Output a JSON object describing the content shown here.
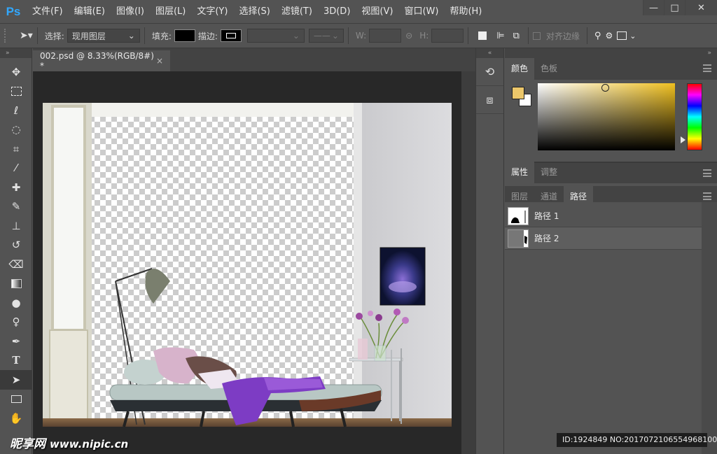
{
  "app": {
    "logo": "Ps"
  },
  "menu": [
    "文件(F)",
    "编辑(E)",
    "图像(I)",
    "图层(L)",
    "文字(Y)",
    "选择(S)",
    "滤镜(T)",
    "3D(D)",
    "视图(V)",
    "窗口(W)",
    "帮助(H)"
  ],
  "window_controls": {
    "minimize": "—",
    "restore": "□",
    "close": "✕"
  },
  "options": {
    "select_label": "选择:",
    "select_value": "现用图层",
    "fill_label": "填充:",
    "stroke_label": "描边:",
    "w_label": "W:",
    "h_label": "H:",
    "align_label": "对齐边缘"
  },
  "document": {
    "tab_title": "002.psd @ 8.33%(RGB/8#) *",
    "close": "×"
  },
  "color_panel": {
    "tabs": [
      "颜色",
      "色板"
    ],
    "foreground": "#ecc76a",
    "background": "#ffffff"
  },
  "props_panel": {
    "tabs": [
      "属性",
      "调整"
    ]
  },
  "paths_panel": {
    "tabs": [
      "图层",
      "通道",
      "路径"
    ],
    "items": [
      {
        "name": "路径 1"
      },
      {
        "name": "路径 2"
      }
    ]
  },
  "status": "ID:1924849 NO:20170721065549681000",
  "watermark": {
    "cn": "昵享网",
    "url": "www.nipic.cn"
  }
}
